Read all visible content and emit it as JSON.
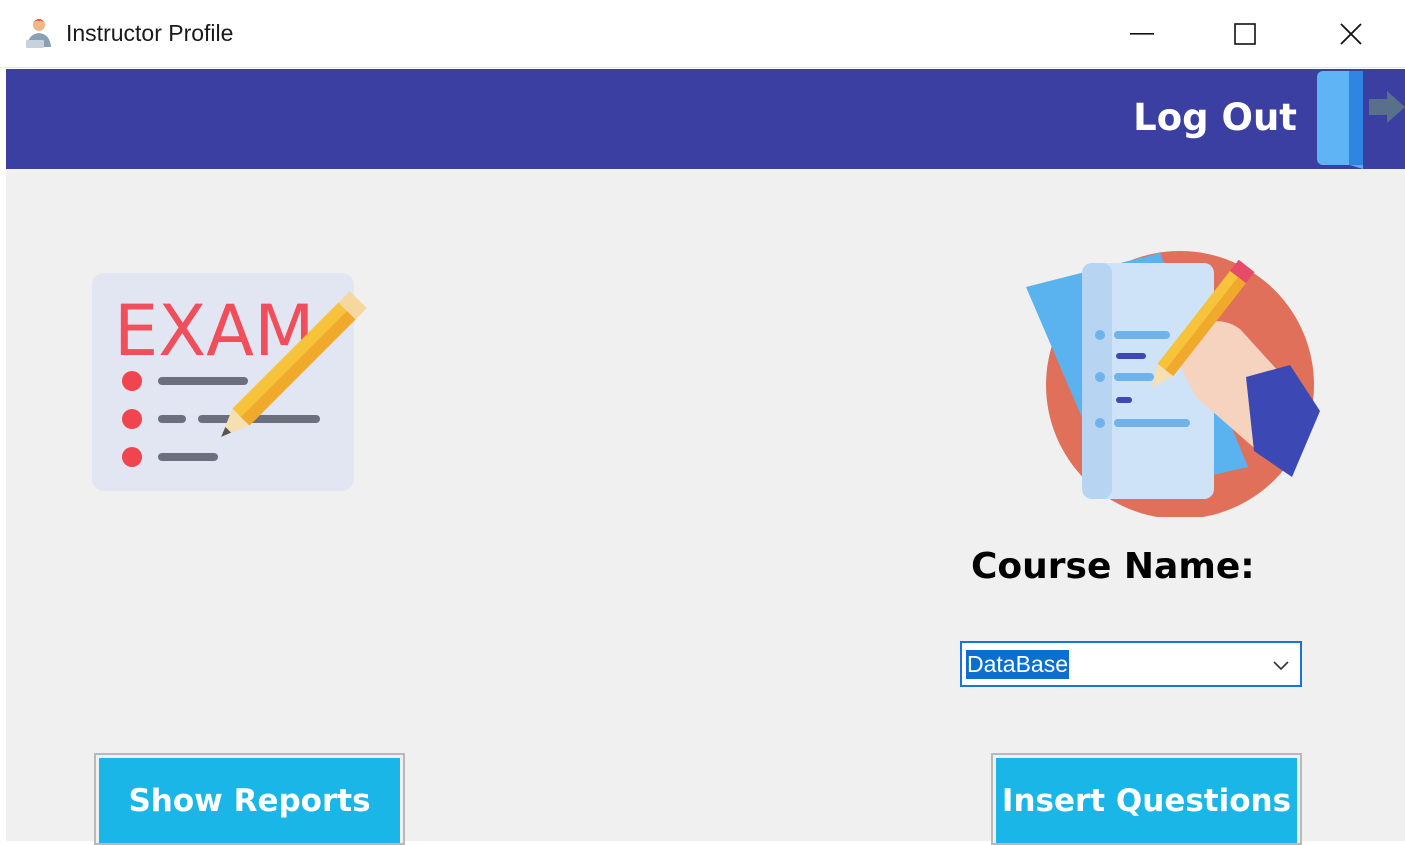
{
  "window": {
    "title": "Instructor Profile",
    "app_icon": "user-avatar-icon",
    "controls": [
      "minimize-icon",
      "maximize-icon",
      "close-icon"
    ]
  },
  "header": {
    "background": "#3b3fa1",
    "logout_label": "Log Out",
    "logout_icon": "door-exit-icon"
  },
  "main": {
    "background": "#f0f0f0",
    "exam_illustration_icon": "exam-paper-pencil-icon",
    "exam_illustration_text": "EXAM",
    "teacher_illustration_icon": "hand-writing-document-icon",
    "course_label": "Course Name:",
    "course_select": {
      "value": "DataBase",
      "selected_highlight": "#0b6fd0",
      "border": "#1a73d9"
    },
    "buttons": {
      "show_reports": "Show Reports",
      "insert_questions": "Insert Questions",
      "color": "#1ab6e8"
    }
  }
}
